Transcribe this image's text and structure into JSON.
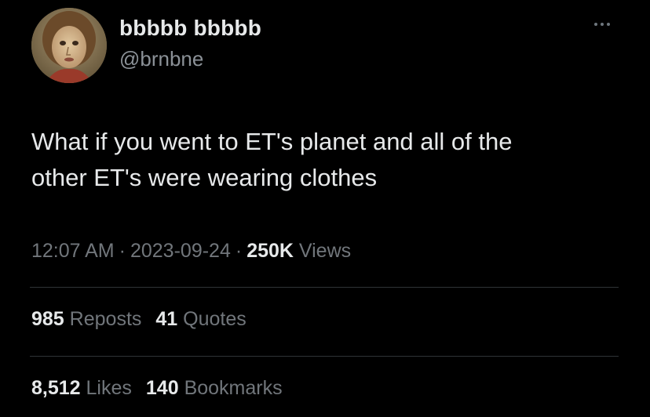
{
  "author": {
    "display_name": "bbbbb bbbbb",
    "handle": "@brnbne",
    "avatar_icon": "painted-portrait-avatar"
  },
  "tweet": {
    "text": "What if you went to ET's planet and all of the\nother ET's were wearing clothes"
  },
  "meta": {
    "time": "12:07 AM",
    "separator": "·",
    "date": "2023-09-24",
    "views_count": "250K",
    "views_label": "Views"
  },
  "stats": {
    "reposts_count": "985",
    "reposts_label": "Reposts",
    "quotes_count": "41",
    "quotes_label": "Quotes",
    "likes_count": "8,512",
    "likes_label": "Likes",
    "bookmarks_count": "140",
    "bookmarks_label": "Bookmarks"
  },
  "colors": {
    "background": "#000000",
    "primary_text": "#e7e9ea",
    "secondary_text": "#71767b",
    "divider": "#2f3336"
  },
  "icons": {
    "more": "more-options-icon"
  }
}
